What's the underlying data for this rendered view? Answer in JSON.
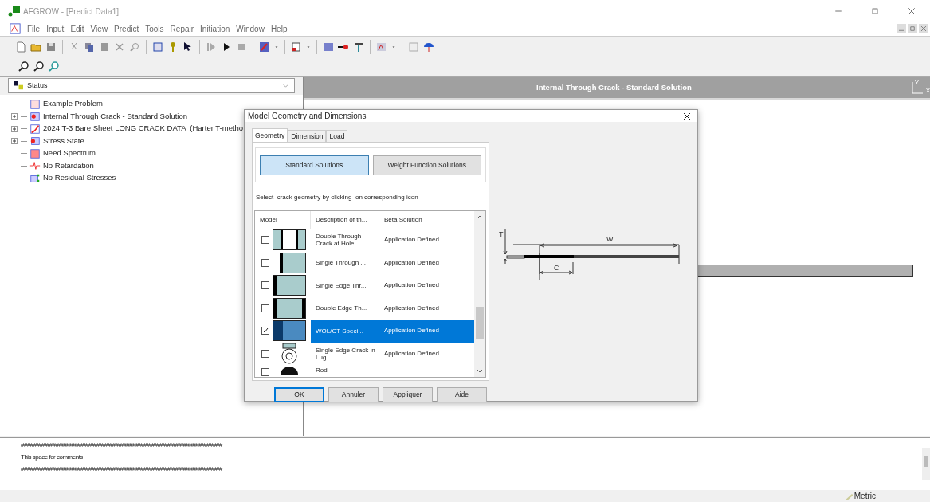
{
  "window": {
    "title": "AFGROW - [Predict Data1]"
  },
  "menu": [
    "File",
    "Input",
    "Edit",
    "View",
    "Predict",
    "Tools",
    "Repair",
    "Initiation",
    "Window",
    "Help"
  ],
  "status_combo": {
    "value": "Status"
  },
  "tree": [
    {
      "label": "Example Problem",
      "kind": "example",
      "collapsible": false
    },
    {
      "label": "Internal Through Crack - Standard Solution",
      "kind": "crack",
      "collapsible": true
    },
    {
      "label": "2024 T-3 Bare Sheet LONG CRACK DATA  (Harter T-metho",
      "kind": "material",
      "collapsible": true
    },
    {
      "label": "Stress State",
      "kind": "stress",
      "collapsible": true
    },
    {
      "label": "Need Spectrum",
      "kind": "spectrum",
      "collapsible": false
    },
    {
      "label": "No Retardation",
      "kind": "retardation",
      "collapsible": false
    },
    {
      "label": "No Residual Stresses",
      "kind": "residual",
      "collapsible": false
    }
  ],
  "view": {
    "title": "Internal Through Crack - Standard Solution",
    "axis_y": "Y",
    "axis_x": "X"
  },
  "dialog": {
    "title": "Model Geometry and Dimensions",
    "tabs": [
      {
        "label": "Geometry",
        "selected": true
      },
      {
        "label": "Dimension",
        "selected": false
      },
      {
        "label": "Load",
        "selected": false
      }
    ],
    "solution_buttons": [
      {
        "label": "Standard Solutions",
        "selected": true
      },
      {
        "label": "Weight Function Solutions",
        "selected": false
      }
    ],
    "instruction": "Select  crack geometry by clicking  on corresponding icon",
    "columns": [
      "Model",
      "Description of th...",
      "Beta Solution"
    ],
    "rows": [
      {
        "kind": "double-through-hole",
        "description": "Double Through Crack at Hole",
        "beta": "Application Defined",
        "checked": false,
        "selected": false
      },
      {
        "kind": "single-through",
        "description": "Single Through ...",
        "beta": "Application Defined",
        "checked": false,
        "selected": false
      },
      {
        "kind": "single-edge",
        "description": "Single Edge Thr...",
        "beta": "Application Defined",
        "checked": false,
        "selected": false
      },
      {
        "kind": "double-edge",
        "description": "Double Edge Th...",
        "beta": "Application Defined",
        "checked": false,
        "selected": false
      },
      {
        "kind": "wol-ct",
        "description": "WOL/CT Speci...",
        "beta": "Application Defined",
        "checked": true,
        "selected": true
      },
      {
        "kind": "lug",
        "description": "Single Edge Crack in Lug",
        "beta": "Application Defined",
        "checked": false,
        "selected": false
      },
      {
        "kind": "rod",
        "description": "Rod",
        "checked": false,
        "selected": false
      }
    ],
    "diagram": {
      "t_label": "T",
      "w_label": "W",
      "c_label": "C"
    },
    "buttons": [
      {
        "label": "OK",
        "default": true
      },
      {
        "label": "Annuler",
        "default": false
      },
      {
        "label": "Appliquer",
        "default": false
      },
      {
        "label": "Aide",
        "default": false
      }
    ]
  },
  "comments": [
    "################################################################",
    "This space for comments",
    "################################################################"
  ],
  "status_bar": {
    "units": "Metric"
  }
}
